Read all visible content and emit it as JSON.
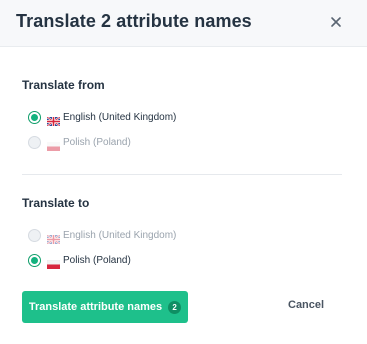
{
  "dialog": {
    "title": "Translate 2 attribute names",
    "close_icon": "close-icon"
  },
  "from": {
    "heading": "Translate from",
    "options": [
      {
        "label": "English (United Kingdom)",
        "flag": "uk-flag-icon",
        "checked": true,
        "disabled": false
      },
      {
        "label": "Polish (Poland)",
        "flag": "poland-flag-icon",
        "checked": false,
        "disabled": true
      }
    ]
  },
  "to": {
    "heading": "Translate to",
    "options": [
      {
        "label": "English (United Kingdom)",
        "flag": "uk-flag-icon",
        "checked": false,
        "disabled": true
      },
      {
        "label": "Polish (Poland)",
        "flag": "poland-flag-icon",
        "checked": true,
        "disabled": false
      }
    ]
  },
  "actions": {
    "primary_label": "Translate attribute names",
    "primary_badge": "2",
    "cancel_label": "Cancel"
  },
  "colors": {
    "accent": "#1ec08b",
    "header_bg": "#f7f8fa"
  }
}
